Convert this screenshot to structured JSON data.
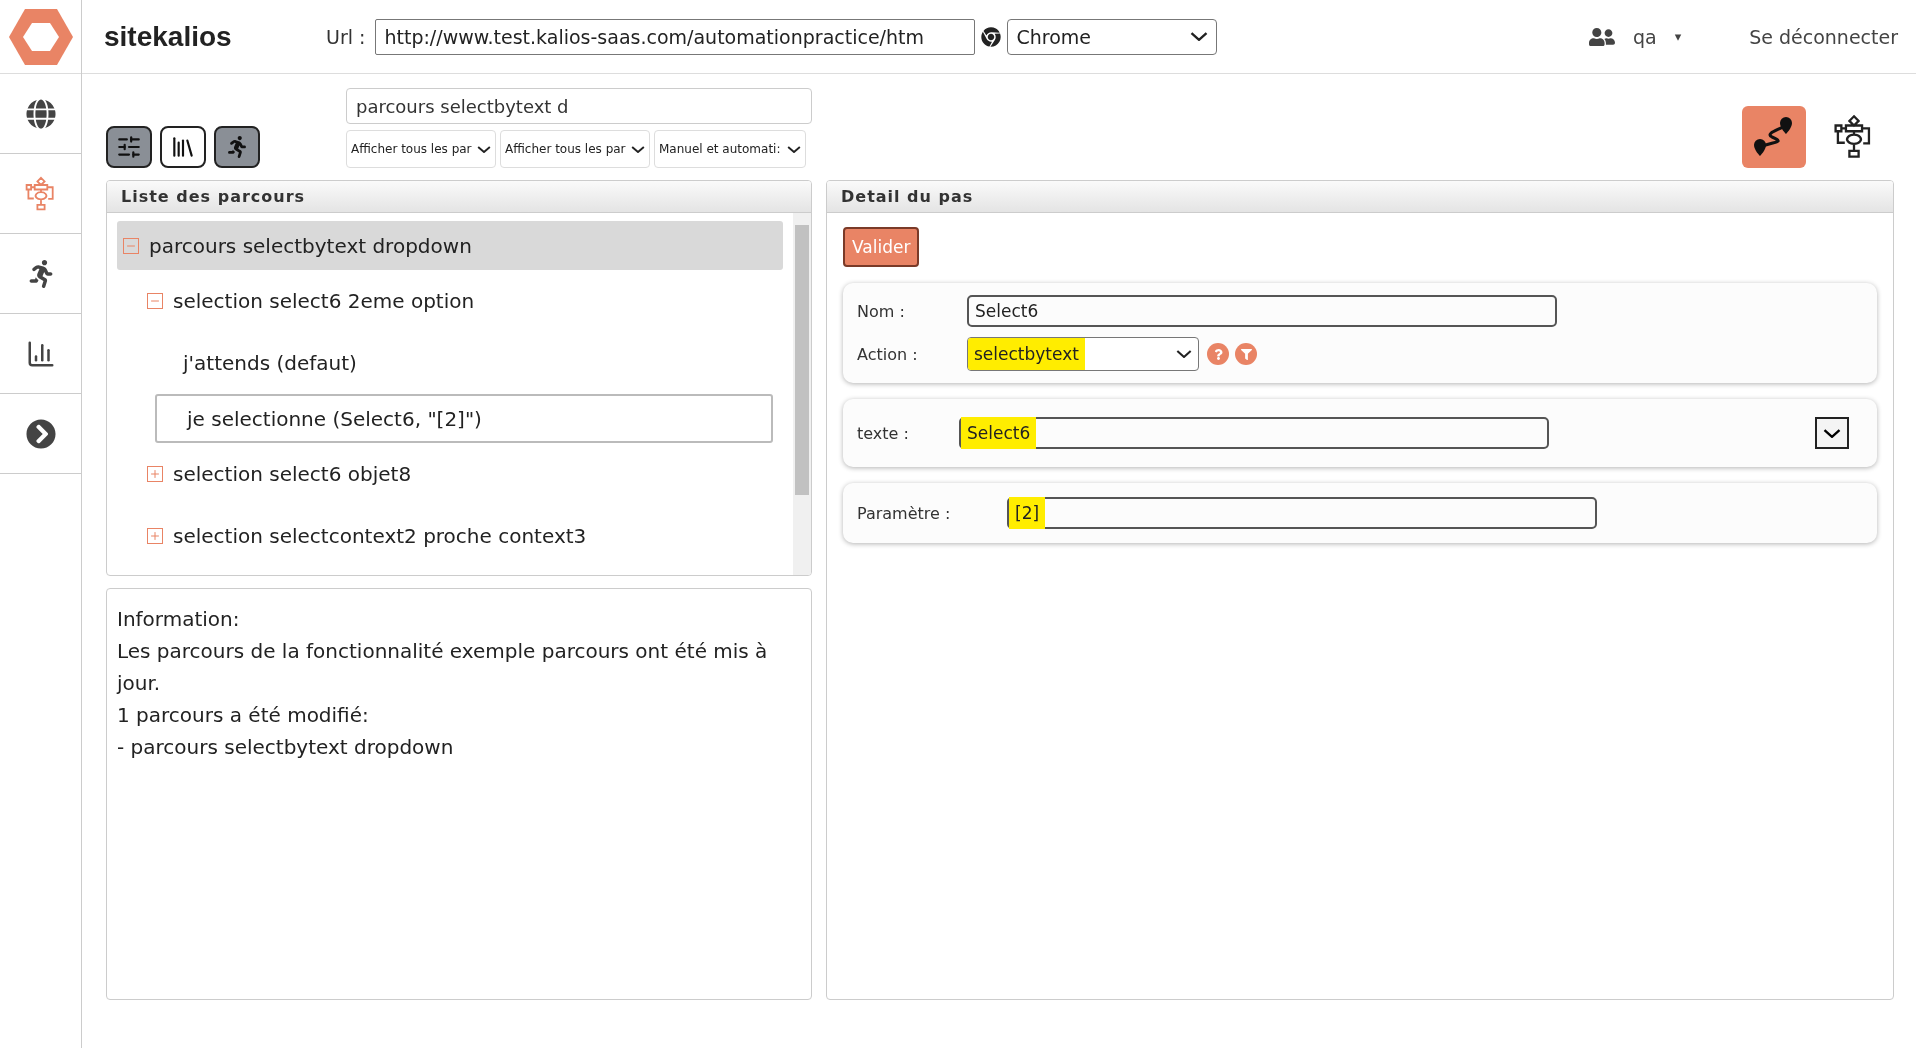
{
  "header": {
    "app_name": "sitekalios",
    "url_label": "Url :",
    "url_value": "http://www.test.kalios-saas.com/automationpractice/htm",
    "browser": "Chrome",
    "user": "qa",
    "user_caret": "▾",
    "logout": "Se déconnecter"
  },
  "sidebar": {
    "items": [
      {
        "kind": "globe",
        "selected": false
      },
      {
        "kind": "flowchart",
        "selected": true
      },
      {
        "kind": "runner",
        "selected": false
      },
      {
        "kind": "chart",
        "selected": false
      },
      {
        "kind": "next",
        "selected": false
      }
    ]
  },
  "toolbar": {
    "buttons": [
      {
        "kind": "sliders",
        "selected": true
      },
      {
        "kind": "books",
        "selected": false
      },
      {
        "kind": "runner",
        "selected": true
      }
    ],
    "search": {
      "value": "parcours selectbytext d"
    },
    "filters": [
      "Afficher tous les par",
      "Afficher tous les par",
      "Manuel et automati:"
    ],
    "views": [
      {
        "kind": "route",
        "selected": true
      },
      {
        "kind": "flowchart",
        "selected": false
      }
    ]
  },
  "list_panel": {
    "title": "Liste des parcours",
    "tree": [
      {
        "label": "parcours selectbytext dropdown",
        "expanded": true,
        "selected": true,
        "outlined": false,
        "children": [
          {
            "label": "selection select6 2eme option",
            "expanded": true,
            "selected": false,
            "outlined": false,
            "children": [
              {
                "label": "j'attends (defaut)",
                "selected": false,
                "outlined": false
              },
              {
                "label": "je selectionne (Select6, \"[2]\")",
                "selected": false,
                "outlined": true
              }
            ]
          },
          {
            "label": "selection select6 objet8",
            "expanded": false,
            "selected": false,
            "outlined": false
          },
          {
            "label": "selection selectcontext2 proche context3",
            "expanded": false,
            "selected": false,
            "outlined": false
          }
        ]
      }
    ]
  },
  "info_panel": {
    "lines": [
      "Information:",
      "Les parcours de la fonctionnalité exemple parcours ont été mis à jour.",
      "1 parcours a été modifié:",
      "- parcours selectbytext dropdown"
    ]
  },
  "detail_panel": {
    "title": "Detail du pas",
    "validate": "Valider",
    "name_label": "Nom :",
    "name_value": "Select6",
    "action_label": "Action :",
    "action_value": "selectbytext",
    "action_highlighted": true,
    "text_label": "texte :",
    "text_value": "Select6",
    "text_highlighted": true,
    "param_label": "Paramètre :",
    "param_value": "[2]",
    "param_highlighted": true
  }
}
